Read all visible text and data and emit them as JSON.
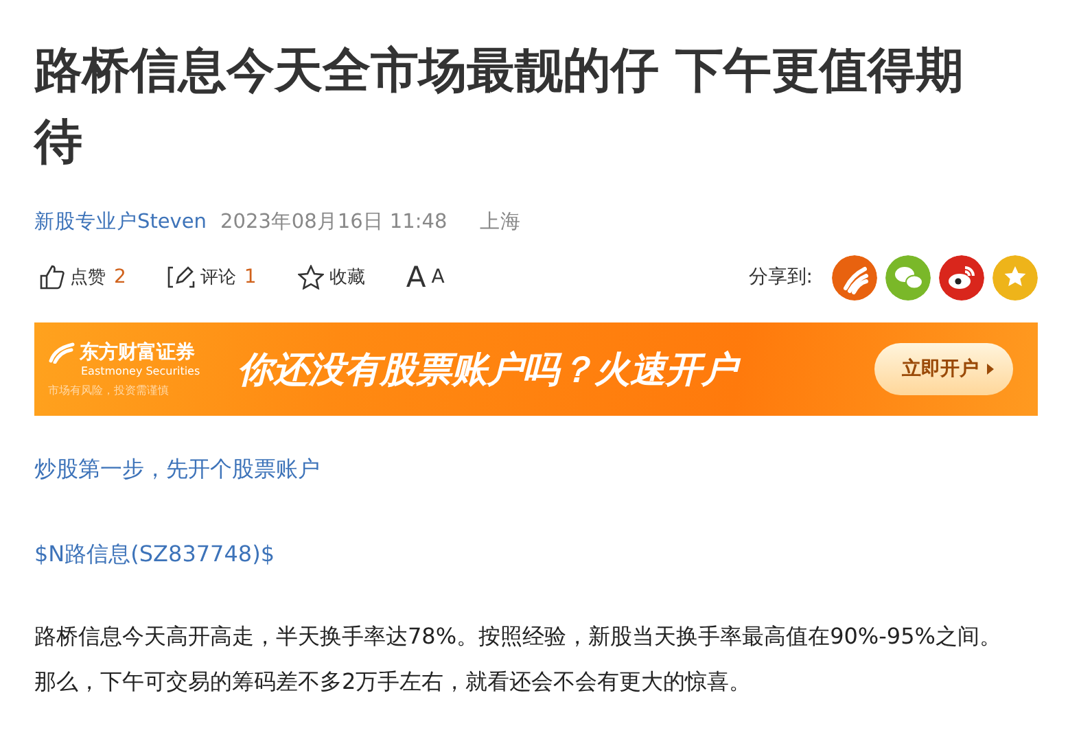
{
  "article": {
    "title": "路桥信息今天全市场最靓的仔 下午更值得期待",
    "author": "新股专业户Steven",
    "time": "2023年08月16日 11:48",
    "location": "上海"
  },
  "actions": [
    {
      "kind": "like",
      "label": "点赞",
      "count": "2"
    },
    {
      "kind": "comment",
      "label": "评论",
      "count": "1"
    },
    {
      "kind": "favorite",
      "label": "收藏"
    },
    {
      "kind": "font",
      "label": "A",
      "small": "A"
    }
  ],
  "share": {
    "label": "分享到:",
    "targets": [
      {
        "kind": "eastmoney",
        "color": "#e8620f"
      },
      {
        "kind": "wechat",
        "color": "#7ab829"
      },
      {
        "kind": "weibo",
        "color": "#d9261c"
      },
      {
        "kind": "star",
        "color": "#eeb41a"
      }
    ]
  },
  "banner": {
    "brand": "东方财富证券",
    "brand_en": "Eastmoney Securities",
    "risk": "市场有风险，投资需谨慎",
    "slogan": "你还没有股票账户吗？火速开户",
    "button": "立即开户"
  },
  "body": [
    {
      "kind": "link",
      "text": "炒股第一步，先开个股票账户"
    },
    {
      "kind": "link",
      "text": "$N路信息(SZ837748)$"
    },
    {
      "kind": "text",
      "text": "路桥信息今天高开高走，半天换手率达78%。按照经验，新股当天换手率最高值在90%-95%之间。那么，下午可交易的筹码差不多2万手左右，就看还会不会有更大的惊喜。"
    }
  ]
}
